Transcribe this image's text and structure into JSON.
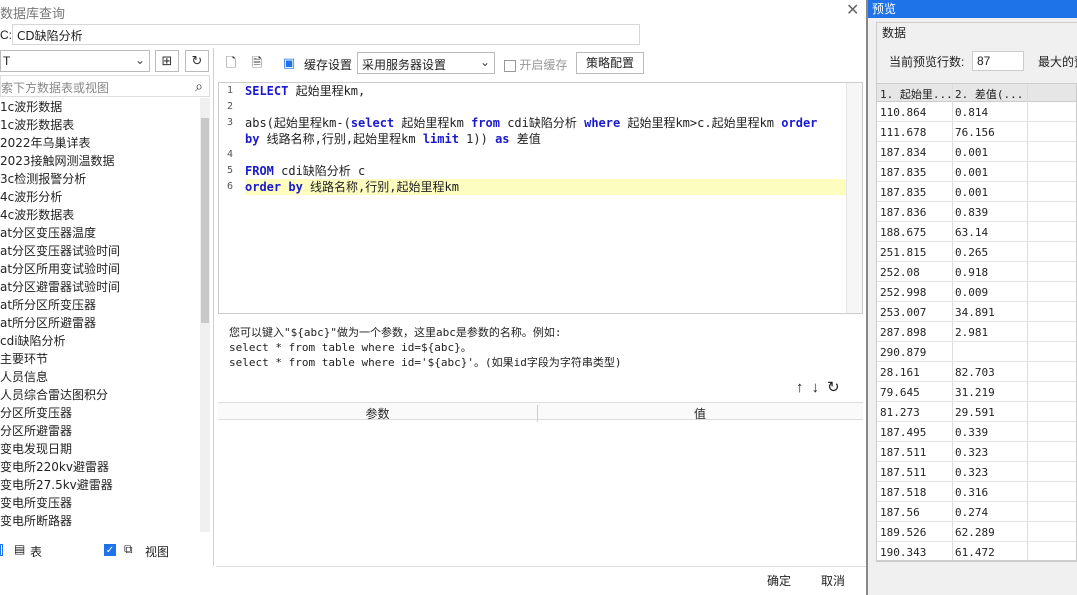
{
  "window": {
    "title": "数据库查询",
    "close_icon": "close-icon"
  },
  "name_field": {
    "label": "C:",
    "value": "CD缺陷分析"
  },
  "left": {
    "datasource_value": "T",
    "search_placeholder": "索下方数据表或视图",
    "tables": [
      "1c波形数据",
      "1c波形数据表",
      "2022年乌巢详表",
      "2023接触网测温数据",
      "3c检测报警分析",
      "4c波形分析",
      "4c波形数据表",
      "at分区变压器温度",
      "at分区变压器试验时间",
      "at分区所用变试验时间",
      "at分区避雷器试验时间",
      "at所分区所变压器",
      "at所分区所避雷器",
      "cdi缺陷分析",
      "主要环节",
      "人员信息",
      "人员综合雷达图积分",
      "分区所变压器",
      "分区所避雷器",
      "变电发现日期",
      "变电所220kv避雷器",
      "变电所27.5kv避雷器",
      "变电所变压器",
      "变电所断路器"
    ],
    "filter": {
      "table_label": "表",
      "view_label": "视图"
    }
  },
  "toolbar": {
    "cache_label": "缓存设置",
    "server_select": "采用服务器设置",
    "enable_cache": "开启缓存",
    "policy_button": "策略配置"
  },
  "editor": {
    "line_numbers": [
      "1",
      "2",
      "3",
      "4",
      "5",
      "6"
    ]
  },
  "hint": {
    "line1": "您可以键入\"${abc}\"做为一个参数，这里abc是参数的名称。例如:",
    "line2": "select * from table where id=${abc}。",
    "line3": "select * from table where id='${abc}'。(如果id字段为字符串类型)"
  },
  "params": {
    "col_param": "参数",
    "col_value": "值"
  },
  "buttons": {
    "ok": "确定",
    "cancel": "取消"
  },
  "preview": {
    "title": "预览",
    "group_label": "数据",
    "rows_label": "当前预览行数:",
    "rows_value": "87",
    "max_label": "最大的预",
    "columns": [
      "1. 起始里...",
      "2. 差值(..."
    ],
    "rows": [
      [
        "110.864",
        "0.814"
      ],
      [
        "111.678",
        "76.156"
      ],
      [
        "187.834",
        "0.001"
      ],
      [
        "187.835",
        "0.001"
      ],
      [
        "187.835",
        "0.001"
      ],
      [
        "187.836",
        "0.839"
      ],
      [
        "188.675",
        "63.14"
      ],
      [
        "251.815",
        "0.265"
      ],
      [
        "252.08",
        "0.918"
      ],
      [
        "252.998",
        "0.009"
      ],
      [
        "253.007",
        "34.891"
      ],
      [
        "287.898",
        "2.981"
      ],
      [
        "290.879",
        ""
      ],
      [
        "28.161",
        "82.703"
      ],
      [
        "79.645",
        "31.219"
      ],
      [
        "81.273",
        "29.591"
      ],
      [
        "187.495",
        "0.339"
      ],
      [
        "187.511",
        "0.323"
      ],
      [
        "187.511",
        "0.323"
      ],
      [
        "187.518",
        "0.316"
      ],
      [
        "187.56",
        "0.274"
      ],
      [
        "189.526",
        "62.289"
      ],
      [
        "190.343",
        "61.472"
      ]
    ]
  }
}
